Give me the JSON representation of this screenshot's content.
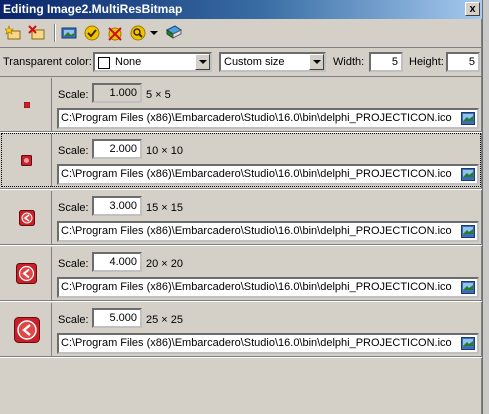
{
  "window": {
    "title": "Editing Image2.MultiResBitmap",
    "close_label": "x"
  },
  "toolbar": {
    "buttons": [
      {
        "name": "new-item-icon"
      },
      {
        "name": "delete-item-icon"
      },
      {
        "name": "load-image-icon"
      },
      {
        "name": "apply-icon"
      },
      {
        "name": "clear-icon"
      },
      {
        "name": "zoom-icon"
      },
      {
        "name": "dropdown-arrow-icon"
      },
      {
        "name": "book-icon"
      }
    ]
  },
  "options": {
    "transparent_label": "Transparent color:",
    "transparent_value": "None",
    "size_mode": "Custom size",
    "width_label": "Width:",
    "width_value": "5",
    "height_label": "Height:",
    "height_value": "5"
  },
  "rows": [
    {
      "scale_label": "Scale:",
      "scale": "1.000",
      "size": "5 × 5",
      "path": "C:\\Program Files (x86)\\Embarcadero\\Studio\\16.0\\bin\\delphi_PROJECTICON.ico"
    },
    {
      "scale_label": "Scale:",
      "scale": "2.000",
      "size": "10 × 10",
      "path": "C:\\Program Files (x86)\\Embarcadero\\Studio\\16.0\\bin\\delphi_PROJECTICON.ico"
    },
    {
      "scale_label": "Scale:",
      "scale": "3.000",
      "size": "15 × 15",
      "path": "C:\\Program Files (x86)\\Embarcadero\\Studio\\16.0\\bin\\delphi_PROJECTICON.ico"
    },
    {
      "scale_label": "Scale:",
      "scale": "4.000",
      "size": "20 × 20",
      "path": "C:\\Program Files (x86)\\Embarcadero\\Studio\\16.0\\bin\\delphi_PROJECTICON.ico"
    },
    {
      "scale_label": "Scale:",
      "scale": "5.000",
      "size": "25 × 25",
      "path": "C:\\Program Files (x86)\\Embarcadero\\Studio\\16.0\\bin\\delphi_PROJECTICON.ico"
    }
  ],
  "colors": {
    "icon_red": "#c8202a",
    "title_start": "#0a246a",
    "title_end": "#a6caf0"
  }
}
